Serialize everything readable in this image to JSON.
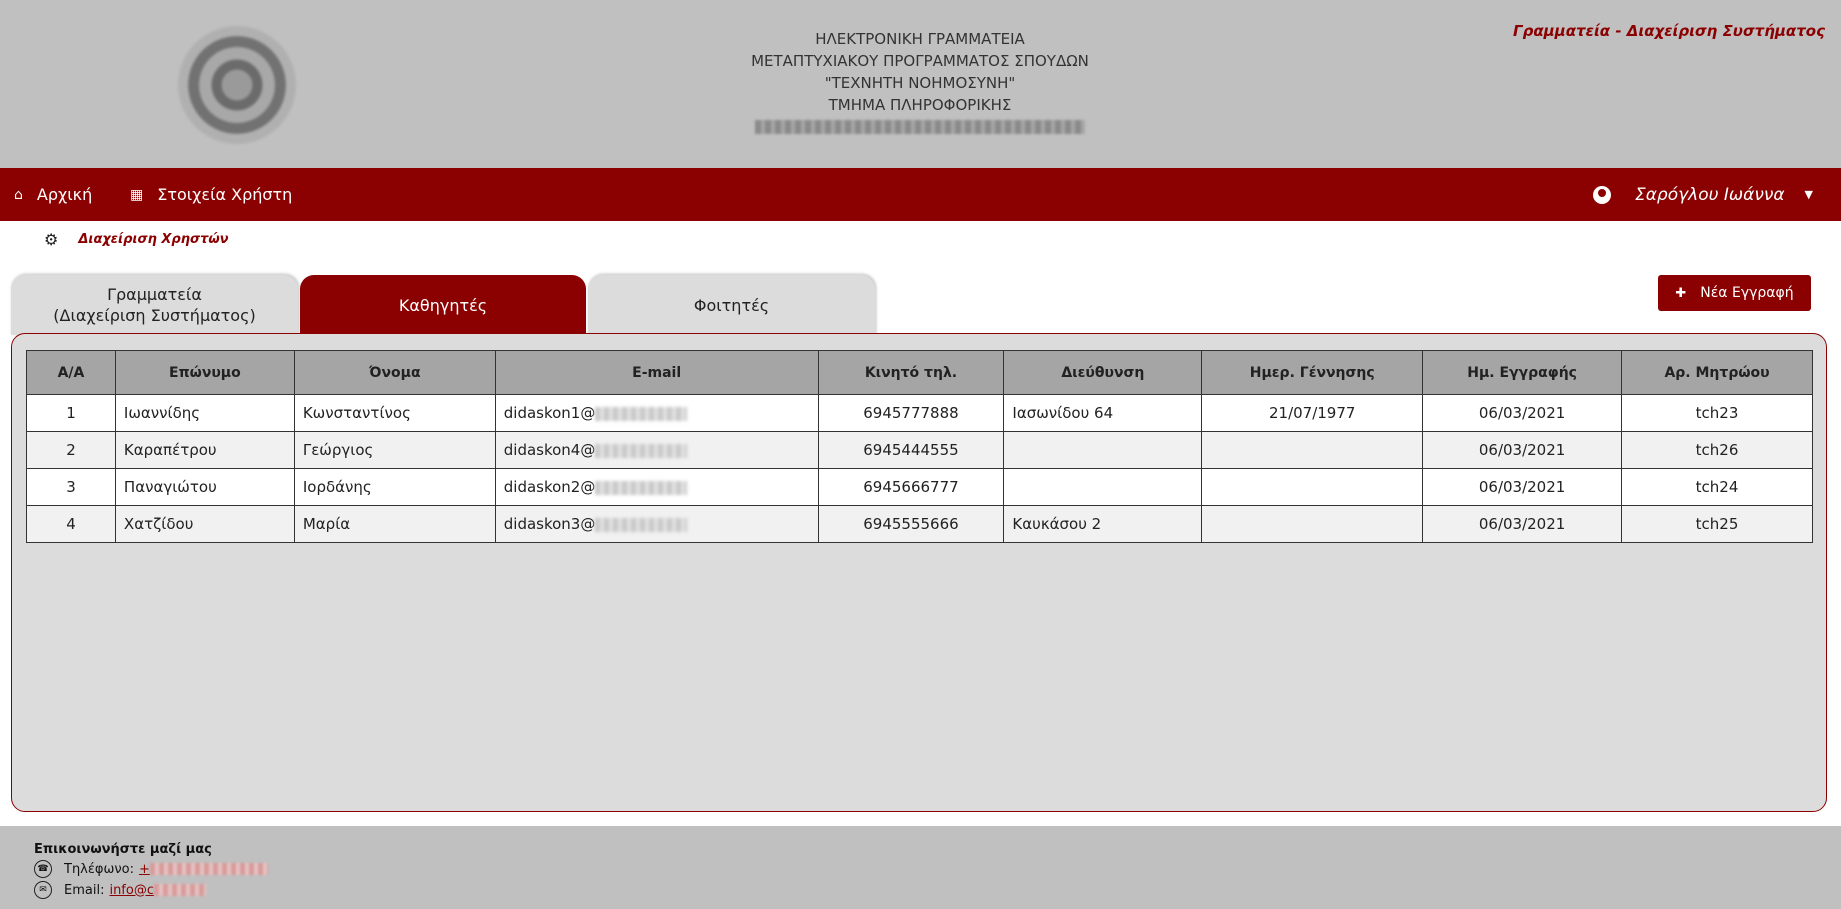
{
  "header": {
    "title_lines": [
      "ΗΛΕΚΤΡΟΝΙΚΗ ΓΡΑΜΜΑΤΕΙΑ",
      "ΜΕΤΑΠΤΥΧΙΑΚΟΥ ΠΡΟΓΡΑΜΜΑΤΟΣ ΣΠΟΥΔΩΝ",
      "\"ΤΕΧΝΗΤΗ ΝΟΗΜΟΣΥΝΗ\"",
      "ΤΜΗΜΑ ΠΛΗΡΟΦΟΡΙΚΗΣ"
    ],
    "brand": "Γραμματεία - Διαχείριση Συστήματος"
  },
  "navbar": {
    "home": "Αρχική",
    "user_details": "Στοιχεία Χρήστη",
    "user_name": "Σαρόγλου Ιωάννα"
  },
  "breadcrumb": {
    "label": "Διαχείριση Χρηστών"
  },
  "tabs": [
    {
      "line1": "Γραμματεία",
      "line2": "(Διαχείριση Συστήματος)"
    },
    {
      "line1": "Καθηγητές",
      "line2": ""
    },
    {
      "line1": "Φοιτητές",
      "line2": ""
    }
  ],
  "active_tab": 1,
  "new_button": "Νέα Εγγραφή",
  "table": {
    "headers": [
      "Α/Α",
      "Επώνυμο",
      "Όνομα",
      "E-mail",
      "Κινητό τηλ.",
      "Διεύθυνση",
      "Ημερ. Γέννησης",
      "Ημ. Εγγραφής",
      "Αρ. Μητρώου"
    ],
    "rows": [
      {
        "aa": "1",
        "surname": "Ιωαννίδης",
        "name": "Κωνσταντίνος",
        "email": "didaskon1@",
        "mobile": "6945777888",
        "address": "Ιασωνίδου 64",
        "birth": "21/07/1977",
        "registered": "06/03/2021",
        "reg_no": "tch23"
      },
      {
        "aa": "2",
        "surname": "Καραπέτρου",
        "name": "Γεώργιος",
        "email": "didaskon4@",
        "mobile": "6945444555",
        "address": "",
        "birth": "",
        "registered": "06/03/2021",
        "reg_no": "tch26"
      },
      {
        "aa": "3",
        "surname": "Παναγιώτου",
        "name": "Ιορδάνης",
        "email": "didaskon2@",
        "mobile": "6945666777",
        "address": "",
        "birth": "",
        "registered": "06/03/2021",
        "reg_no": "tch24"
      },
      {
        "aa": "4",
        "surname": "Χατζίδου",
        "name": "Μαρία",
        "email": "didaskon3@",
        "mobile": "6945555666",
        "address": "Καυκάσου 2",
        "birth": "",
        "registered": "06/03/2021",
        "reg_no": "tch25"
      }
    ]
  },
  "footer": {
    "title": "Επικοινωνήστε μαζί μας",
    "phone_label": "Τηλέφωνο:",
    "phone_visible": "+",
    "email_label": "Email:",
    "email_visible": "info@c"
  },
  "colors": {
    "primary": "#8b0000",
    "header_bg": "#c0c0c0",
    "panel_bg": "#dcdcdc",
    "table_header_bg": "#a5a5a5"
  }
}
